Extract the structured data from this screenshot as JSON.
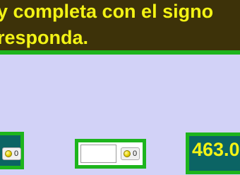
{
  "instruction": {
    "line1": "y completa con el signo",
    "line2": "responda."
  },
  "left_card": {
    "coin_count": "0"
  },
  "middle_card": {
    "input_value": "",
    "coin_count": "0"
  },
  "right_card": {
    "value": "463.0"
  },
  "colors": {
    "background": "#d2d2f7",
    "banner": "#3d3209",
    "border": "#1db51d",
    "text": "#f3f315",
    "teal": "#0b6464"
  }
}
